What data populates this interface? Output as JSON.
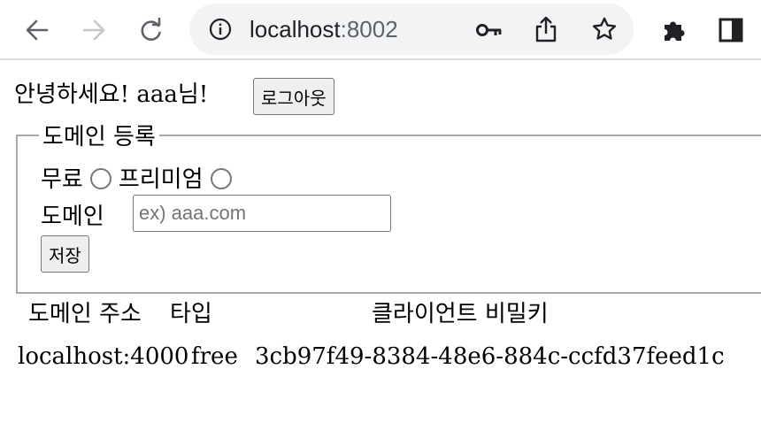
{
  "browser": {
    "url_host": "localhost",
    "url_port": ":8002",
    "icons": [
      "back-arrow-icon",
      "forward-arrow-icon",
      "reload-icon",
      "info-icon",
      "key-icon",
      "share-icon",
      "star-icon",
      "extensions-icon",
      "side-panel-icon"
    ]
  },
  "header": {
    "greeting": "안녕하세요! aaa님!",
    "logout_label": "로그아웃"
  },
  "domain_form": {
    "legend": "도메인 등록",
    "plan_free_label": "무료",
    "plan_premium_label": "프리미엄",
    "domain_label": "도메인",
    "domain_value": "",
    "domain_placeholder": "ex) aaa.com",
    "save_label": "저장"
  },
  "domain_table": {
    "headers": [
      "도메인 주소",
      "타입",
      "클라이언트 비밀키"
    ],
    "rows": [
      [
        "localhost:4000",
        "free",
        "3cb97f49-8384-48e6-884c-ccfd37feed1c"
      ]
    ]
  }
}
